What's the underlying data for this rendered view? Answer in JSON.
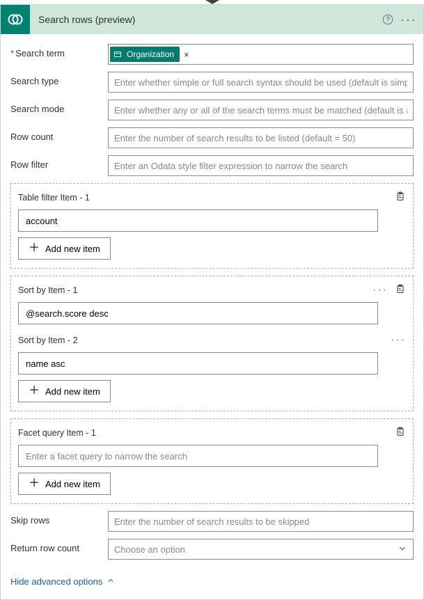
{
  "header": {
    "title": "Search rows (preview)"
  },
  "fields": {
    "searchTerm": {
      "label": "Search term",
      "required": true,
      "tokenLabel": "Organization"
    },
    "searchType": {
      "label": "Search type",
      "placeholder": "Enter whether simple or full search syntax should be used (default is simple)"
    },
    "searchMode": {
      "label": "Search mode",
      "placeholder": "Enter whether any or all of the search terms must be matched (default is any)"
    },
    "rowCount": {
      "label": "Row count",
      "placeholder": "Enter the number of search results to be listed (default = 50)"
    },
    "rowFilter": {
      "label": "Row filter",
      "placeholder": "Enter an Odata style filter expression to narrow the search"
    },
    "skipRows": {
      "label": "Skip rows",
      "placeholder": "Enter the number of search results to be skipped"
    },
    "returnRowCount": {
      "label": "Return row count",
      "placeholder": "Choose an option"
    }
  },
  "tableFilter": {
    "item1Label": "Table filter Item - 1",
    "item1Value": "account",
    "addLabel": "Add new item"
  },
  "sortBy": {
    "item1Label": "Sort by Item - 1",
    "item1Value": "@search.score desc",
    "item2Label": "Sort by Item - 2",
    "item2Value": "name asc",
    "addLabel": "Add new item"
  },
  "facet": {
    "item1Label": "Facet query Item - 1",
    "placeholder": "Enter a facet query to narrow the search",
    "addLabel": "Add new item"
  },
  "footer": {
    "hideLabel": "Hide advanced options"
  }
}
